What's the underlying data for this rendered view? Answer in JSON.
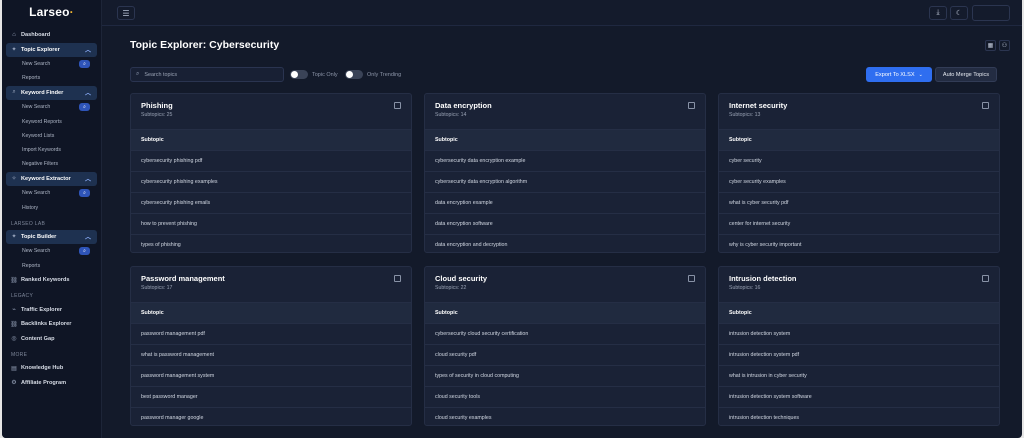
{
  "app": {
    "logo": "Larseo"
  },
  "sidebar": {
    "topic_explorer": {
      "label": "Topic Explorer",
      "subs": [
        "New Search",
        "Reports"
      ]
    },
    "keyword_finder": {
      "label": "Keyword Finder",
      "subs": [
        "New Search",
        "Keyword Reports",
        "Keyword Lists",
        "Import Keywords",
        "Negative Filters"
      ]
    },
    "keyword_extractor": {
      "label": "Keyword Extractor",
      "subs": [
        "New Search",
        "History"
      ]
    },
    "dashboard": "Dashboard",
    "section_lab": "LARSEO LAB",
    "topic_builder": {
      "label": "Topic Builder",
      "subs": [
        "New Search",
        "Reports"
      ]
    },
    "ranked_keywords": "Ranked Keywords",
    "section_legacy": "LEGACY",
    "traffic_explorer": "Traffic Explorer",
    "backlinks_explorer": "Backlinks Explorer",
    "content_gap": "Content Gap",
    "section_more": "MORE",
    "knowledge_hub": "Knowledge Hub",
    "affiliate_program": "Affiliate Program"
  },
  "page": {
    "title": "Topic Explorer: Cybersecurity",
    "search_placeholder": "Search topics",
    "toggle_topic_only": "Topic Only",
    "toggle_only_trending": "Only Trending",
    "export_label": "Export To XLSX",
    "merge_label": "Auto Merge Topics"
  },
  "cards": [
    {
      "title": "Phishing",
      "subtopics": "Subtopics: 25",
      "header": "Subtopic",
      "rows": [
        "cybersecurity phishing pdf",
        "cybersecurity phishing examples",
        "cybersecurity phishing emails",
        "how to prevent phishing",
        "types of phishing"
      ]
    },
    {
      "title": "Data encryption",
      "subtopics": "Subtopics: 14",
      "header": "Subtopic",
      "rows": [
        "cybersecurity data encryption example",
        "cybersecurity data encryption algorithm",
        "data encryption example",
        "data encryption software",
        "data encryption and decryption"
      ]
    },
    {
      "title": "Internet security",
      "subtopics": "Subtopics: 13",
      "header": "Subtopic",
      "rows": [
        "cyber security",
        "cyber security examples",
        "what is cyber security pdf",
        "center for internet security",
        "why is cyber security important"
      ]
    },
    {
      "title": "Password management",
      "subtopics": "Subtopics: 17",
      "header": "Subtopic",
      "rows": [
        "password management pdf",
        "what is password management",
        "password management system",
        "best password manager",
        "password manager google"
      ]
    },
    {
      "title": "Cloud security",
      "subtopics": "Subtopics: 22",
      "header": "Subtopic",
      "rows": [
        "cybersecurity cloud security certification",
        "cloud security pdf",
        "types of security in cloud computing",
        "cloud security tools",
        "cloud security examples"
      ]
    },
    {
      "title": "Intrusion detection",
      "subtopics": "Subtopics: 16",
      "header": "Subtopic",
      "rows": [
        "intrusion detection system",
        "intrusion detection system pdf",
        "what is intrusion in cyber security",
        "intrusion detection system software",
        "intrusion detection techniques"
      ]
    }
  ]
}
